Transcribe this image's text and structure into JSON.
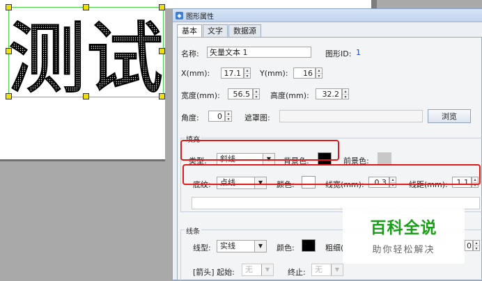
{
  "canvas": {
    "text_object": "测试"
  },
  "dialog": {
    "title": "图形属性",
    "tabs": [
      "基本",
      "文字",
      "数据源"
    ],
    "name_label": "名称:",
    "name_value": "矢量文本 1",
    "shape_id_label": "图形ID:",
    "shape_id_value": "1",
    "x_label": "X(mm):",
    "x_value": "17.1",
    "y_label": "Y(mm):",
    "y_value": "16",
    "width_label": "宽度(mm):",
    "width_value": "56.5",
    "height_label": "高度(mm):",
    "height_value": "32.2",
    "angle_label": "角度:",
    "angle_value": "0",
    "mask_label": "遮罩图:",
    "browse_label": "浏览",
    "fill": {
      "title": "填充",
      "type_label": "类型:",
      "type_value": "斜线",
      "bg_label": "背景色:",
      "bg_color": "#000000",
      "fg_label": "前景色:",
      "fg_color": "#c8c8c8",
      "texture_label": "底纹:",
      "texture_value": "点线",
      "color_label": "颜色:",
      "color_value": "#ffffff",
      "line_width_label": "线宽(mm):",
      "line_width_value": "0.3",
      "line_spacing_label": "线距(mm):",
      "line_spacing_value": "1.1"
    },
    "stroke": {
      "title": "线条",
      "line_type_label": "线型:",
      "line_type_value": "实线",
      "color_label": "颜色:",
      "color_value": "#000000",
      "thickness_label": "粗细(",
      "thickness_value": "0",
      "arrow_label": "[箭头] 起始:",
      "arrow_start_value": "无",
      "arrow_end_label": "终止:",
      "arrow_end_value": "无"
    }
  },
  "watermark": {
    "title": "百科全说",
    "subtitle": "助你轻松解决"
  },
  "colors": {
    "highlight_box": "#e01818",
    "selection_border": "#43d843",
    "handle": "#f0e000",
    "watermark_green": "#1a9e1a"
  }
}
